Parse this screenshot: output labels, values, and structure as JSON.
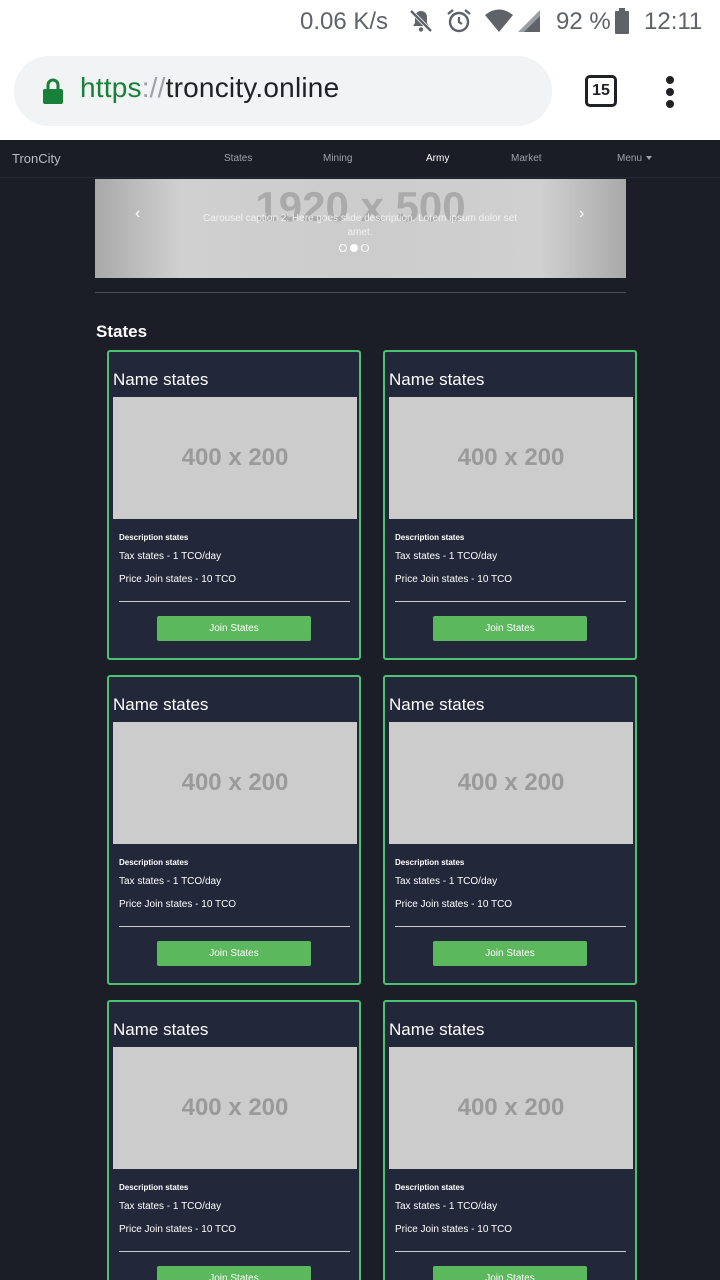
{
  "status_bar": {
    "net_speed": "0.06 K/s",
    "battery_percent": "92 %",
    "time": "12:11",
    "icons": [
      "mute-icon",
      "alarm-icon",
      "wifi-icon",
      "signal-icon",
      "battery-icon"
    ]
  },
  "browser": {
    "url_scheme": "https",
    "url_sep": "://",
    "url_host": "troncity.online",
    "tab_count": "15",
    "colors": {
      "secure": "#188038"
    }
  },
  "navbar": {
    "brand": "TronCity",
    "links": [
      "States",
      "Mining",
      "Army",
      "Market",
      "Menu"
    ],
    "active": "Army"
  },
  "carousel": {
    "placeholder": "1920 x 500",
    "caption": "Carousel caption 2. Here goes slide description. Lorem ipsum dolor set amet.",
    "prev": "‹",
    "next": "›",
    "slide_count": 3,
    "active_slide": 2
  },
  "section": {
    "title": "States"
  },
  "cards": [
    {
      "title": "Name states",
      "image": "400 x 200",
      "desc": "Description states",
      "tax": "Tax states - 1 TCO/day",
      "price": "Price Join states - 10 TCO",
      "button": "Join States"
    },
    {
      "title": "Name states",
      "image": "400 x 200",
      "desc": "Description states",
      "tax": "Tax states - 1 TCO/day",
      "price": "Price Join states - 10 TCO",
      "button": "Join States"
    },
    {
      "title": "Name states",
      "image": "400 x 200",
      "desc": "Description states",
      "tax": "Tax states - 1 TCO/day",
      "price": "Price Join states - 10 TCO",
      "button": "Join States"
    },
    {
      "title": "Name states",
      "image": "400 x 200",
      "desc": "Description states",
      "tax": "Tax states - 1 TCO/day",
      "price": "Price Join states - 10 TCO",
      "button": "Join States"
    },
    {
      "title": "Name states",
      "image": "400 x 200",
      "desc": "Description states",
      "tax": "Tax states - 1 TCO/day",
      "price": "Price Join states - 10 TCO",
      "button": "Join States"
    },
    {
      "title": "Name states",
      "image": "400 x 200",
      "desc": "Description states",
      "tax": "Tax states - 1 TCO/day",
      "price": "Price Join states - 10 TCO",
      "button": "Join States"
    }
  ],
  "colors": {
    "page_bg": "#1b1e27",
    "card_bg": "#222839",
    "card_border": "#4cc16f",
    "button": "#5cb85c"
  }
}
